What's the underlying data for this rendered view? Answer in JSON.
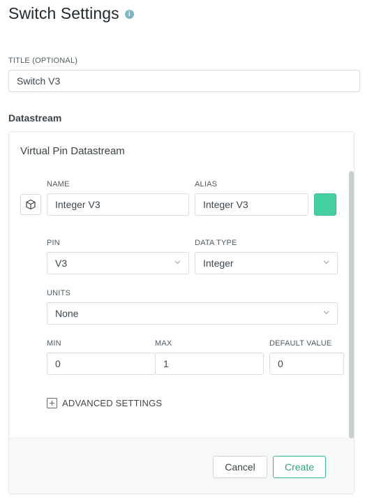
{
  "header": {
    "title": "Switch Settings",
    "info_icon": "info-icon"
  },
  "title_field": {
    "label": "TITLE (OPTIONAL)",
    "value": "Switch V3"
  },
  "datastream": {
    "heading": "Datastream",
    "card_title": "Virtual Pin Datastream",
    "name": {
      "label": "NAME",
      "value": "Integer V3"
    },
    "alias": {
      "label": "ALIAS",
      "value": "Integer V3"
    },
    "color": "#45cfa0",
    "pin": {
      "label": "PIN",
      "value": "V3"
    },
    "data_type": {
      "label": "DATA TYPE",
      "value": "Integer"
    },
    "units": {
      "label": "UNITS",
      "value": "None"
    },
    "min": {
      "label": "MIN",
      "value": "0"
    },
    "max": {
      "label": "MAX",
      "value": "1"
    },
    "default_value": {
      "label": "DEFAULT VALUE",
      "value": "0"
    },
    "advanced_label": "ADVANCED SETTINGS"
  },
  "footer": {
    "cancel_label": "Cancel",
    "create_label": "Create"
  }
}
